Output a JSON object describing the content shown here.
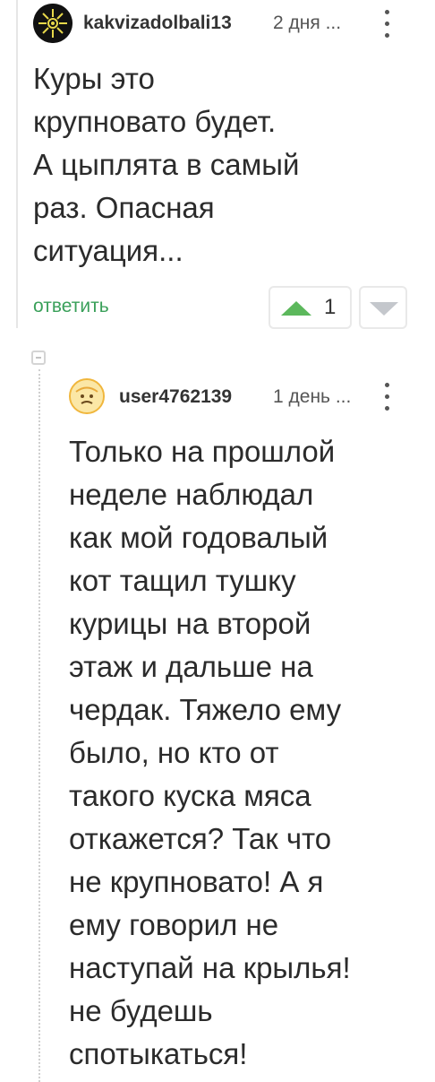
{
  "comment": {
    "username": "kakvizadolbali13",
    "time": "2 дня ...",
    "text": "Куры это\nкрупновато будет.\nА цыплята в самый\nраз. Опасная\nситуация...",
    "reply_label": "ответить",
    "votes": "1",
    "icons": [
      "avatar",
      "more-vertical-icon",
      "arrow-up-icon",
      "arrow-down-icon"
    ]
  },
  "reply": {
    "username": "user4762139",
    "time": "1 день ...",
    "text": "Только на прошлой\nнеделе наблюдал\nкак мой годовалый\nкот тащил тушку\nкурицы на второй\nэтаж и дальше на\nчердак. Тяжело ему\nбыло, но кто от\nтакого куска мяса\nоткажется? Так что\nне крупновато! А я\nему говорил не\nнаступай на крылья!\nне будешь\nспотыкаться!",
    "icons": [
      "avatar",
      "more-vertical-icon",
      "collapse-icon"
    ]
  },
  "colors": {
    "accent_green": "#3aa05a",
    "vote_arrow_up": "#5cb85c",
    "vote_arrow_down": "#c4c7cc",
    "thread_line": "#e6e6e6"
  }
}
